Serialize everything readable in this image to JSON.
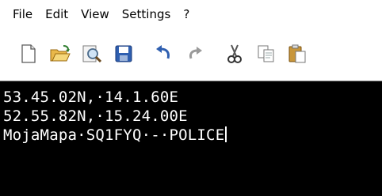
{
  "menu": {
    "items": [
      "File",
      "Edit",
      "View",
      "Settings",
      "?"
    ]
  },
  "toolbar": {
    "buttons": [
      {
        "icon": "new-file-icon"
      },
      {
        "icon": "open-folder-icon"
      },
      {
        "icon": "find-icon"
      },
      {
        "icon": "save-icon"
      },
      {
        "icon": "undo-icon"
      },
      {
        "icon": "redo-icon"
      },
      {
        "icon": "cut-icon"
      },
      {
        "icon": "copy-icon"
      },
      {
        "icon": "paste-icon"
      }
    ]
  },
  "editor": {
    "lines": [
      "53.45.02N,·14.1.60E",
      "52.55.82N,·15.24.00E",
      "MojaMapa·SQ1FYQ·-·POLICE"
    ],
    "background": "#000000",
    "text_color": "#ffffff"
  }
}
